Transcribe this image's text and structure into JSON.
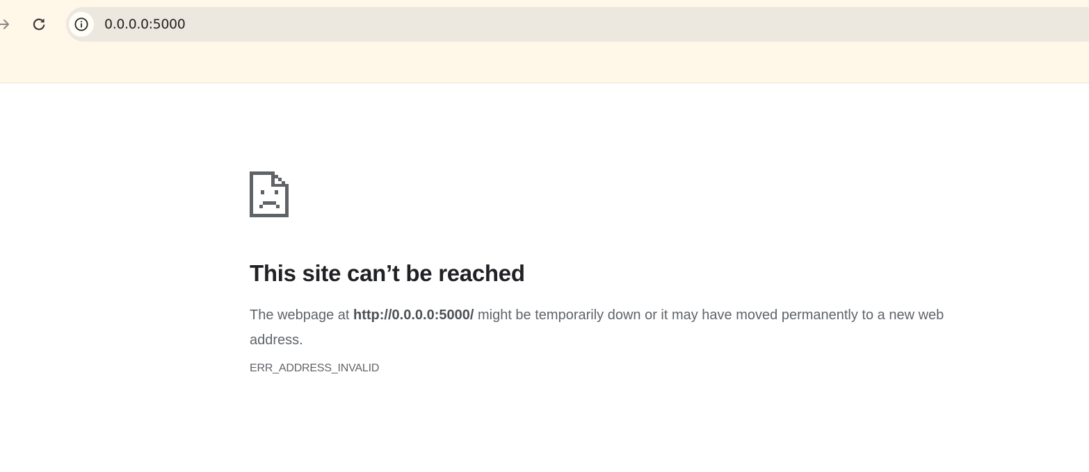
{
  "browser": {
    "address_bar": {
      "url": "0.0.0.0:5000",
      "site_info_icon": "info-circle-icon"
    },
    "forward_icon": "arrow-right-icon",
    "reload_icon": "reload-icon"
  },
  "error_page": {
    "icon": "sad-document-icon",
    "title": "This site can’t be reached",
    "description_prefix": "The webpage at ",
    "description_url": "http://0.0.0.0:5000/",
    "description_suffix": " might be temporarily down or it may have moved permanently to a new web address.",
    "error_code": "ERR_ADDRESS_INVALID"
  },
  "colors": {
    "toolbar_bg": "#fff8e9",
    "omnibox_bg": "#ede8df",
    "title_text": "#202124",
    "body_text": "#5f6368"
  }
}
